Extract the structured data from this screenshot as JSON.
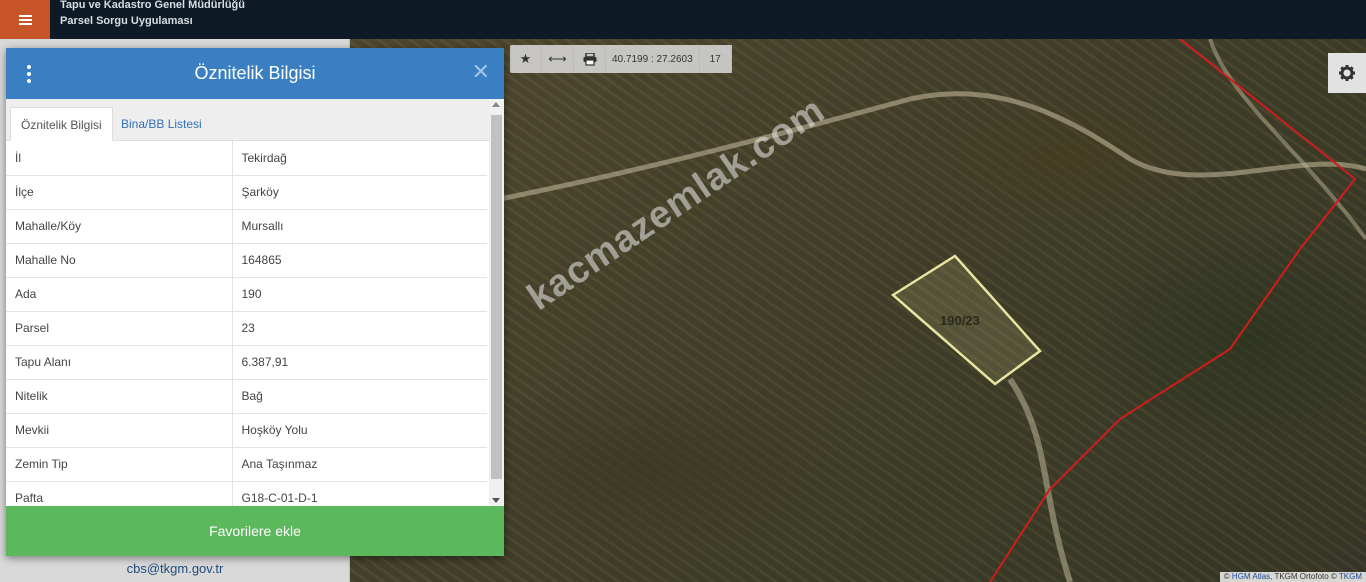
{
  "app": {
    "title_line1": "Tapu ve Kadastro Genel Müdürlüğü",
    "title_line2": "Parsel Sorgu Uygulaması"
  },
  "sidebar": {
    "email": "cbs@tkgm.gov.tr"
  },
  "map": {
    "toolbar": {
      "coordinates": "40.7199 : 27.2603",
      "zoom": "17"
    },
    "watermark": "kacmazemlak.com",
    "parcel_label": "190/23",
    "attribution": {
      "prefix": "© ",
      "link1": "HGM Atlas",
      "middle": ", TKGM Ortofoto © ",
      "link2": "TKGM"
    },
    "colors": {
      "parcel_outline": "#e8e3a0",
      "boundary_line": "#d11c1c"
    }
  },
  "panel": {
    "title": "Öznitelik Bilgisi",
    "close_glyph": "✕",
    "tabs": [
      {
        "label": "Öznitelik Bilgisi",
        "active": true
      },
      {
        "label": "Bina/BB Listesi",
        "active": false
      }
    ],
    "rows": [
      {
        "key": "İl",
        "value": "Tekirdağ"
      },
      {
        "key": "İlçe",
        "value": "Şarköy"
      },
      {
        "key": "Mahalle/Köy",
        "value": "Mursallı"
      },
      {
        "key": "Mahalle No",
        "value": "164865"
      },
      {
        "key": "Ada",
        "value": "190"
      },
      {
        "key": "Parsel",
        "value": "23"
      },
      {
        "key": "Tapu Alanı",
        "value": "6.387,91"
      },
      {
        "key": "Nitelik",
        "value": "Bağ"
      },
      {
        "key": "Mevkii",
        "value": "Hoşköy Yolu"
      },
      {
        "key": "Zemin Tip",
        "value": "Ana Taşınmaz"
      },
      {
        "key": "Pafta",
        "value": "G18-C-01-D-1"
      }
    ],
    "favorite_button": "Favorilere ekle",
    "colors": {
      "header": "#3a7fc2",
      "favorite_button": "#5cb85c"
    }
  }
}
